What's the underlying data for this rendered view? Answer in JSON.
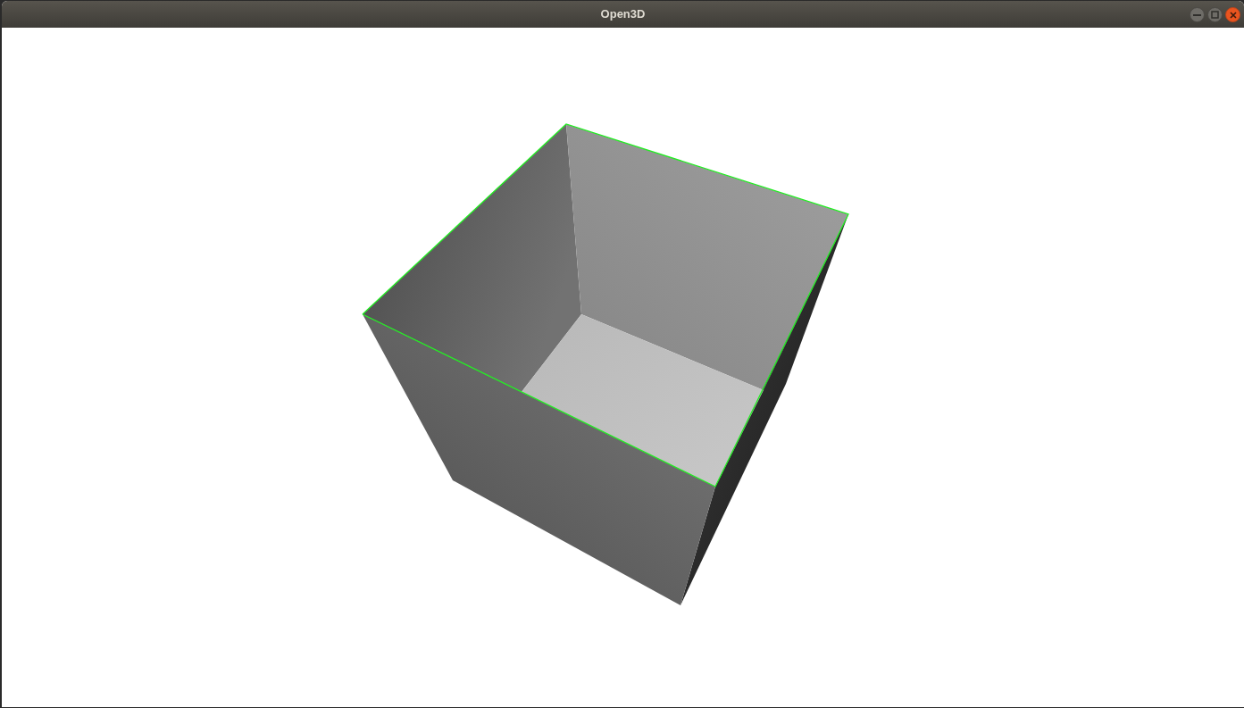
{
  "window": {
    "title": "Open3D"
  }
}
